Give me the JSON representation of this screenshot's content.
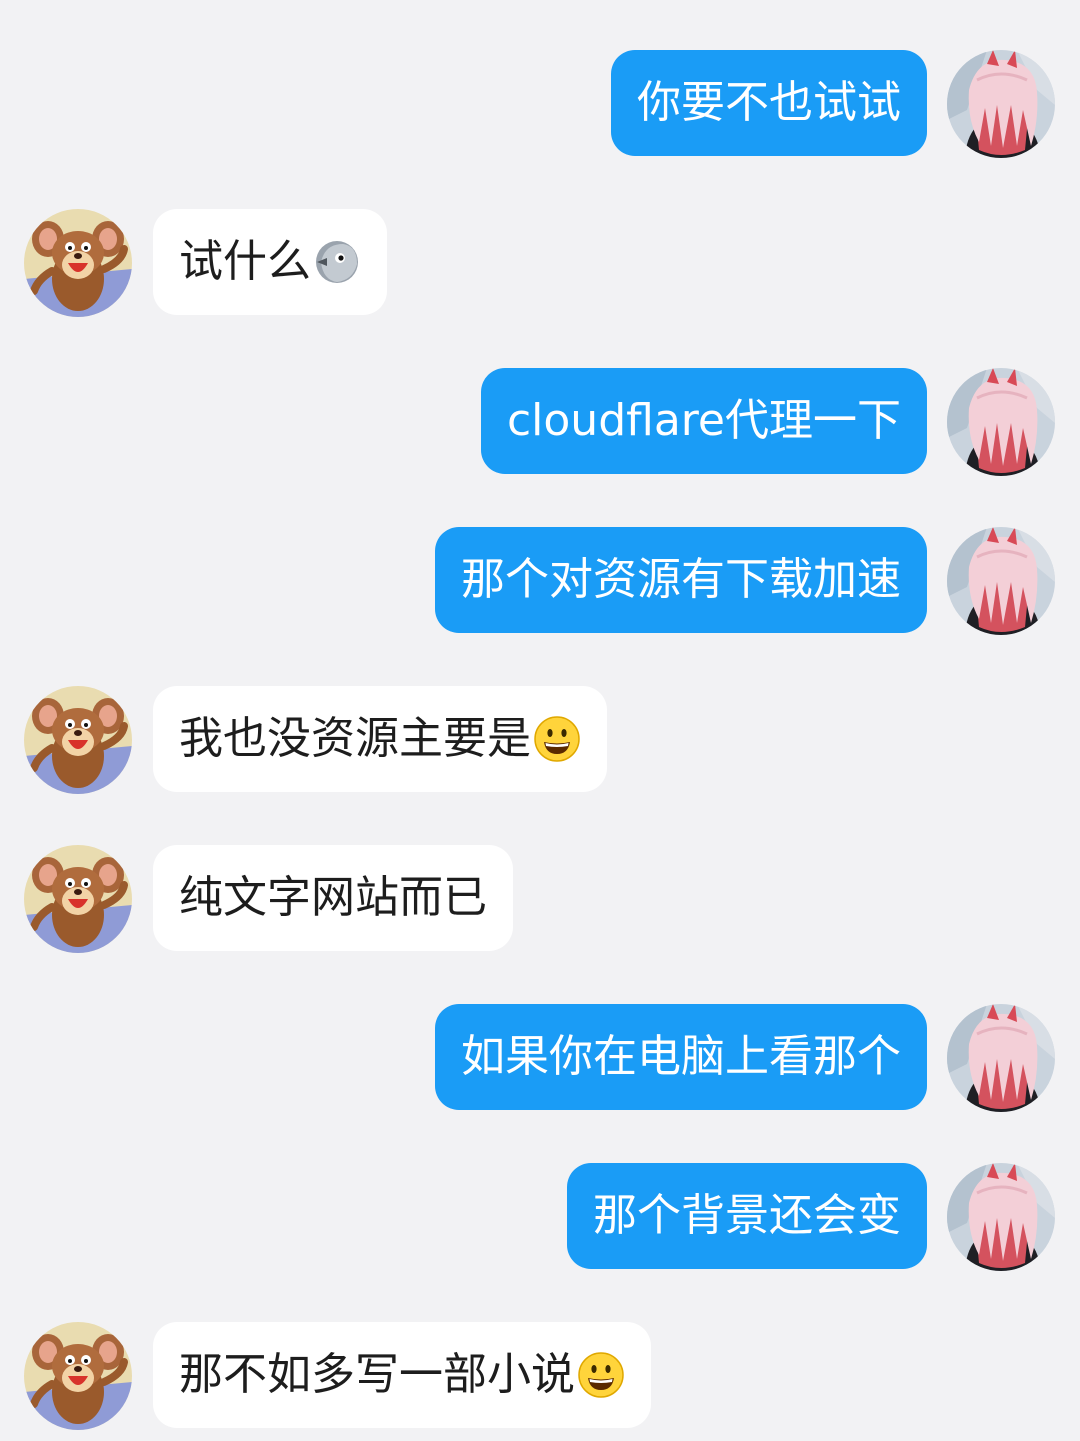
{
  "chat": {
    "messages": [
      {
        "side": "sent",
        "text": "你要不也试试",
        "emoji": null
      },
      {
        "side": "recv",
        "text": "试什么",
        "emoji": "bird-face-icon"
      },
      {
        "side": "sent",
        "text": "cloudflare代理一下",
        "emoji": null
      },
      {
        "side": "sent",
        "text": "那个对资源有下载加速",
        "emoji": null
      },
      {
        "side": "recv",
        "text": "我也没资源主要是",
        "emoji": "grinning-face-icon"
      },
      {
        "side": "recv",
        "text": "纯文字网站而已",
        "emoji": null
      },
      {
        "side": "sent",
        "text": "如果你在电脑上看那个",
        "emoji": null
      },
      {
        "side": "sent",
        "text": "那个背景还会变",
        "emoji": null
      },
      {
        "side": "recv",
        "text": "那不如多写一部小说",
        "emoji": "grinning-face-icon"
      }
    ]
  },
  "colors": {
    "background": "#f2f2f4",
    "sent_bubble": "#1a9cf6",
    "sent_text": "#ffffff",
    "recv_bubble": "#ffffff",
    "recv_text": "#1d1d1d"
  },
  "avatars": {
    "sent": "pink-hair-anime-avatar",
    "recv": "cartoon-mouse-avatar"
  }
}
